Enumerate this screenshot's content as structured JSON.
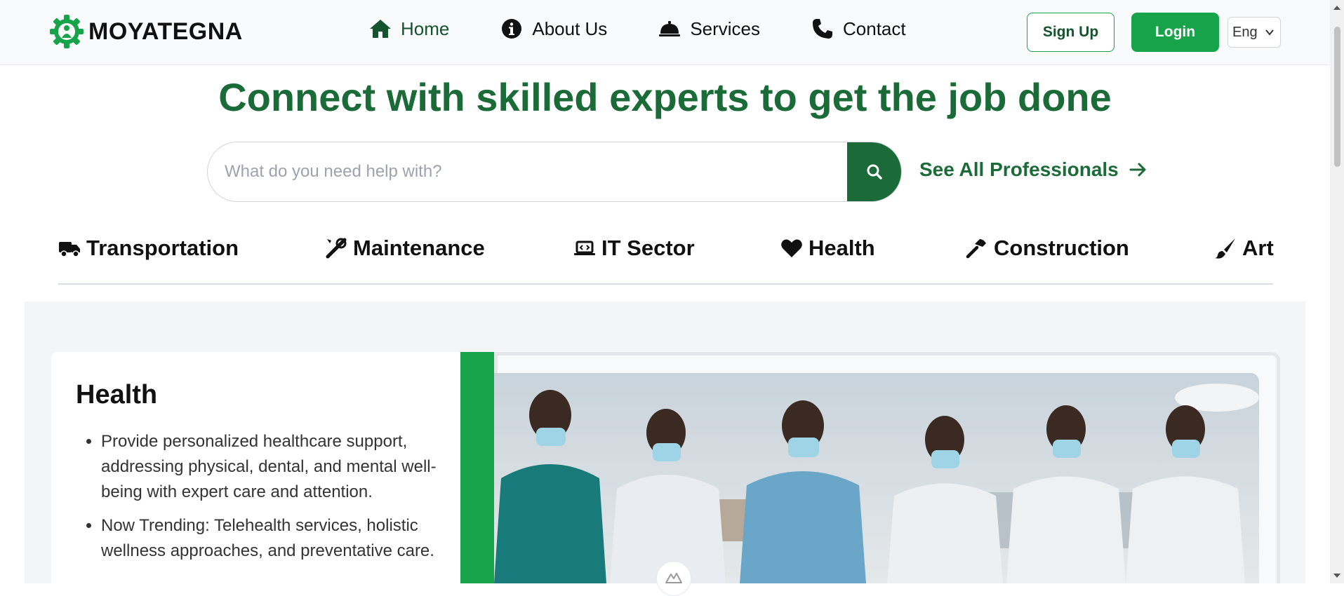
{
  "header": {
    "brand": "MOYATEGNA",
    "nav": [
      {
        "label": "Home",
        "icon": "home-icon",
        "active": true
      },
      {
        "label": "About Us",
        "icon": "info-icon"
      },
      {
        "label": "Services",
        "icon": "service-bell-icon"
      },
      {
        "label": "Contact",
        "icon": "phone-icon"
      }
    ],
    "signup_label": "Sign Up",
    "login_label": "Login",
    "language": "Eng"
  },
  "hero": {
    "title": "Connect with skilled experts to get the job done",
    "search_placeholder": "What do you need help with?",
    "see_all_label": "See All Professionals"
  },
  "categories": [
    {
      "label": "Transportation",
      "icon": "truck-icon"
    },
    {
      "label": "Maintenance",
      "icon": "tools-icon"
    },
    {
      "label": "IT Sector",
      "icon": "laptop-code-icon"
    },
    {
      "label": "Health",
      "icon": "heart-icon"
    },
    {
      "label": "Construction",
      "icon": "hammer-icon"
    },
    {
      "label": "Art",
      "icon": "paintbrush-icon"
    }
  ],
  "feature": {
    "title": "Health",
    "bullets": [
      "Provide personalized healthcare support, addressing physical, dental, and mental well-being with expert care and attention.",
      "Now Trending: Telehealth services, holistic wellness approaches, and preventative care."
    ],
    "image_alt": "group-of-healthcare-workers-photo"
  },
  "colors": {
    "brand_green": "#1b6b38",
    "accent_green": "#16a34a",
    "header_bg": "#f9fafb"
  }
}
